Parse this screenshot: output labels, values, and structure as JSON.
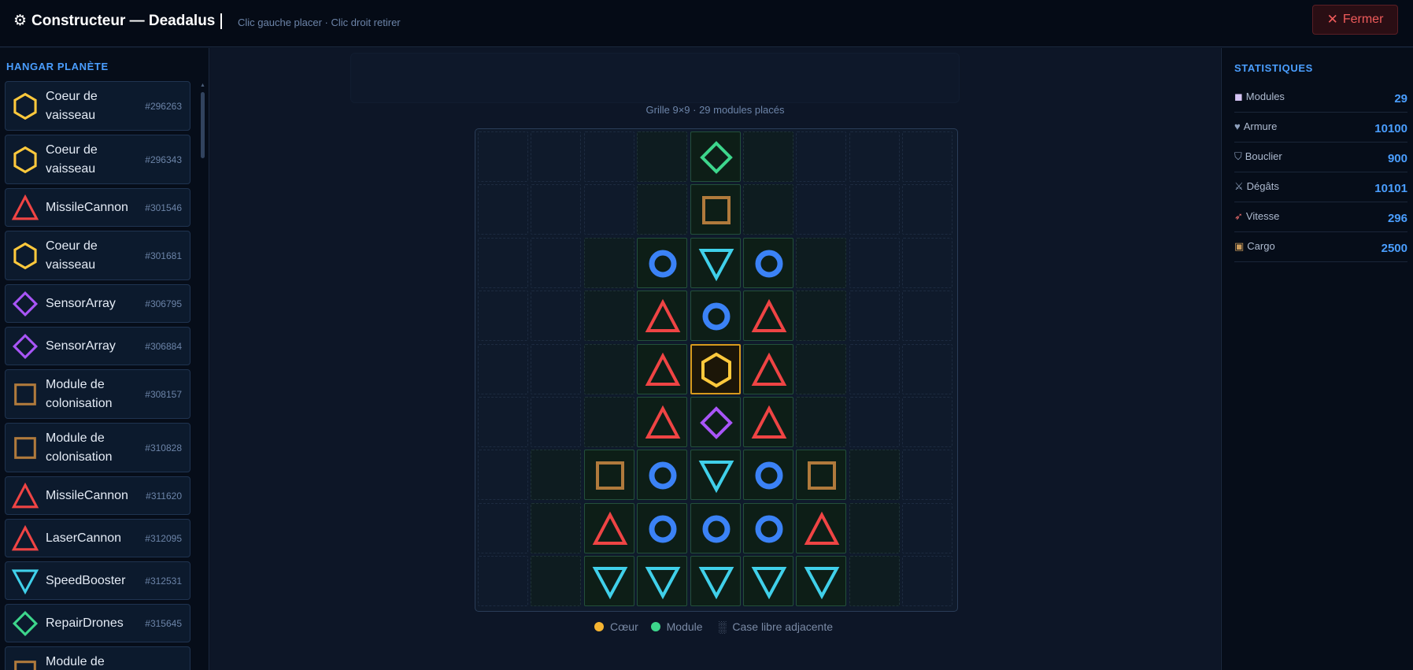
{
  "header": {
    "title": "Constructeur — Deadalus",
    "hint": "Clic gauche placer · Clic droit retirer",
    "close_label": "Fermer"
  },
  "colors": {
    "core": "#ffc93c",
    "weapon": "#ef4444",
    "shield": "#3b82f6",
    "speed": "#40d0ea",
    "sensor": "#a855f7",
    "repair": "#3dd68c",
    "cargo": "#b07a3c",
    "accent": "#4a9eff"
  },
  "hangar": {
    "title": "HANGAR PLANÈTE",
    "items": [
      {
        "label": "Coeur de vaisseau",
        "id": "#296263",
        "icon": "hexagon-icon",
        "kind": "core"
      },
      {
        "label": "Coeur de vaisseau",
        "id": "#296343",
        "icon": "hexagon-icon",
        "kind": "core"
      },
      {
        "label": "MissileCannon",
        "id": "#301546",
        "icon": "triangle-icon",
        "kind": "weapon"
      },
      {
        "label": "Coeur de vaisseau",
        "id": "#301681",
        "icon": "hexagon-icon",
        "kind": "core"
      },
      {
        "label": "SensorArray",
        "id": "#306795",
        "icon": "diamond-icon",
        "kind": "sensor"
      },
      {
        "label": "SensorArray",
        "id": "#306884",
        "icon": "diamond-icon",
        "kind": "sensor"
      },
      {
        "label": "Module de colonisation",
        "id": "#308157",
        "icon": "square-icon",
        "kind": "cargo"
      },
      {
        "label": "Module de colonisation",
        "id": "#310828",
        "icon": "square-icon",
        "kind": "cargo"
      },
      {
        "label": "MissileCannon",
        "id": "#311620",
        "icon": "triangle-icon",
        "kind": "weapon"
      },
      {
        "label": "LaserCannon",
        "id": "#312095",
        "icon": "triangle-icon",
        "kind": "weapon"
      },
      {
        "label": "SpeedBooster",
        "id": "#312531",
        "icon": "inverted-triangle-icon",
        "kind": "speed"
      },
      {
        "label": "RepairDrones",
        "id": "#315645",
        "icon": "diamond-icon",
        "kind": "repair"
      },
      {
        "label": "Module de colonisation",
        "id": "",
        "icon": "square-icon",
        "kind": "cargo"
      }
    ]
  },
  "grid": {
    "caption": "Grille 9×9 · 29 modules placés",
    "rows": [
      [
        ".",
        ".",
        ".",
        "a",
        "G",
        "a",
        ".",
        ".",
        "."
      ],
      [
        ".",
        ".",
        ".",
        "a",
        "S",
        "a",
        ".",
        ".",
        "."
      ],
      [
        ".",
        ".",
        "a",
        "O",
        "V",
        "O",
        "a",
        ".",
        "."
      ],
      [
        ".",
        ".",
        "a",
        "T",
        "O",
        "T",
        "a",
        ".",
        "."
      ],
      [
        ".",
        ".",
        "a",
        "T",
        "H",
        "T",
        "a",
        ".",
        "."
      ],
      [
        ".",
        ".",
        "a",
        "T",
        "D",
        "T",
        "a",
        ".",
        "."
      ],
      [
        ".",
        "a",
        "S",
        "O",
        "V",
        "O",
        "S",
        "a",
        "."
      ],
      [
        ".",
        "a",
        "T",
        "O",
        "O",
        "O",
        "T",
        "a",
        "."
      ],
      [
        ".",
        "a",
        "V",
        "V",
        "V",
        "V",
        "V",
        "a",
        "."
      ]
    ]
  },
  "legend": {
    "core": "Cœur",
    "module": "Module",
    "free": "Case libre adjacente"
  },
  "stats": {
    "title": "STATISTIQUES",
    "rows": [
      {
        "icon": "cube-icon",
        "glyph": "◼",
        "glyph_color": "#d6c5f5",
        "label": "Modules",
        "value": "29"
      },
      {
        "icon": "heart-icon",
        "glyph": "♥",
        "glyph_color": "#8ea0bd",
        "label": "Armure",
        "value": "10100"
      },
      {
        "icon": "shield-icon",
        "glyph": "⛉",
        "glyph_color": "#8ea0bd",
        "label": "Bouclier",
        "value": "900"
      },
      {
        "icon": "swords-icon",
        "glyph": "⚔",
        "glyph_color": "#8ea0bd",
        "label": "Dégâts",
        "value": "10101"
      },
      {
        "icon": "rocket-icon",
        "glyph": "➶",
        "glyph_color": "#e86b6b",
        "label": "Vitesse",
        "value": "296"
      },
      {
        "icon": "package-icon",
        "glyph": "▣",
        "glyph_color": "#c99a5b",
        "label": "Cargo",
        "value": "2500"
      }
    ]
  }
}
